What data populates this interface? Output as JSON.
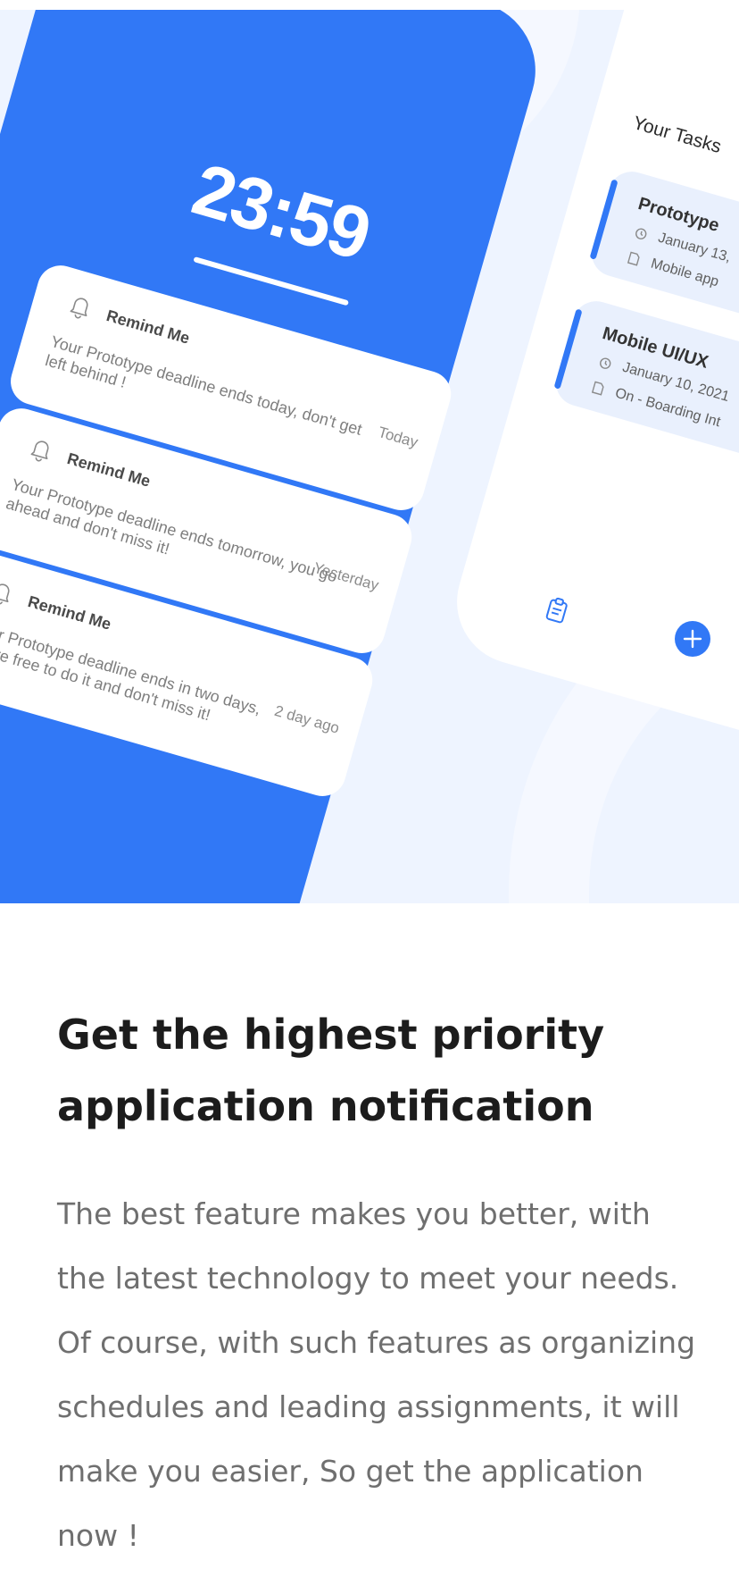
{
  "hero": {
    "clock": "23:59",
    "reminders": [
      {
        "title": "Remind Me",
        "message": "Your Prototype deadline ends today, don't get left behind !",
        "time": "Today"
      },
      {
        "title": "Remind Me",
        "message": "Your Prototype deadline ends tomorrow, you go ahead and don't miss it!",
        "time": "Yesterday"
      },
      {
        "title": "Remind Me",
        "message": "Your Prototype deadline ends in two days, you're free to do it and don't miss it!",
        "time": "2 day ago"
      }
    ],
    "tasks_title": "Your Tasks",
    "tasks": [
      {
        "name": "Prototype",
        "date": "January 13,",
        "category": "Mobile app"
      },
      {
        "name": "Mobile UI/UX",
        "date": "January 10, 2021",
        "category": "On - Boarding Int"
      }
    ],
    "icons": {
      "reminder": "bell-icon",
      "task_date": "alarm-clock-icon",
      "task_category": "document-icon",
      "nav_tasks": "clipboard-icon",
      "add": "plus-icon"
    }
  },
  "content": {
    "heading_line1": "Get the highest priority",
    "heading_line2": "application notification",
    "body": "The best feature makes you better, with the latest technology to meet your needs. Of course, with such features as organizing schedules and leading assignments, it will make you easier, So get the application now !"
  },
  "colors": {
    "accent": "#3178f6",
    "background_tint": "#eef4ff",
    "heading": "#1c1c1c",
    "body": "#6f6f6f"
  }
}
